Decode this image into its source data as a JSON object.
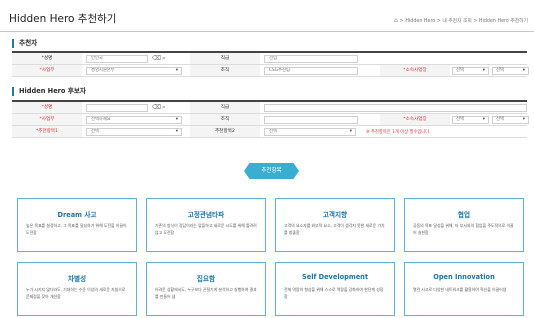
{
  "header": {
    "title": "Hidden Hero 추천하기",
    "breadcrumb": "> Hidden Hero > 내 추천자 조회 > Hidden Hero 추천하기"
  },
  "recommender": {
    "section_title": "추천자",
    "rows": [
      {
        "label1": "*성명",
        "value1": "인인국",
        "label2": "직급",
        "value2": "선임"
      },
      {
        "label1": "*사업부",
        "value1": "경영지원본부",
        "label2": "조직",
        "value2": "CSG추진팀",
        "label3": "*소속사업장",
        "select_a": "선택",
        "select_b": "선택"
      }
    ]
  },
  "hero": {
    "section_title": "Hidden Hero 후보자",
    "rows": [
      {
        "label1": "*성명",
        "value1": "",
        "label2": "직급",
        "value2": ""
      },
      {
        "label1": "*사업부",
        "value1": "선택하세요",
        "label2": "조직",
        "value2": "",
        "label3": "*소속사업장",
        "select_a": "선택",
        "select_b": "선택"
      },
      {
        "label1": "*추천항목1",
        "value1": "선택",
        "label2": "추천항목2",
        "value2": "선택",
        "notice": "※ 추천항목은 1개 이상 필수입니다."
      }
    ]
  },
  "recommend_button": "추천항목",
  "cards": [
    {
      "title": "Dream 사고",
      "desc": "높은 목표를 설정하고, 그 목표를 달성하기 위해 도전을 이끌어 도전함"
    },
    {
      "title": "고정관념타파",
      "desc": "기존의 방식이 정답이라는 맞을하고 새로운 시도를 위해 틀려려 않고 도전함"
    },
    {
      "title": "고객지향",
      "desc": "고객의 요소자를 외부적 요소, 고객이 생각지 못한 새로운 가치를 창출함"
    },
    {
      "title": "협업",
      "desc": "공동의 목표 달성을 위해, 타 부서와의 협업을 주도적으로 이끌어 실현함"
    },
    {
      "title": "차별성",
      "desc": "누가 시키지 않더라도, 기대하는 수준 이상의 새로운 지침으로 문제점을 찾아 개선함"
    },
    {
      "title": "집요함",
      "desc": "어려운 상황에서도, 누구보다 끈질기게 분석하고 실행하여 결과를 만들어 냄"
    },
    {
      "title": "Self Development",
      "desc": "전체 역량의 향상을 위해 스스로 역량을 강화하여 한단계 성장함"
    },
    {
      "title": "Open Innovation",
      "desc": "열린 사고로 다양한 네트워크를 활용하여 혁신을 이끌어냄"
    }
  ],
  "colors": {
    "accent": "#3aaed0",
    "card_title": "#1c74a8",
    "card_border": "#5fb3d3",
    "required": "#d33333"
  },
  "icons": {
    "search": "magnifier-icon",
    "clear": "eraser-icon",
    "home": "home-icon"
  }
}
